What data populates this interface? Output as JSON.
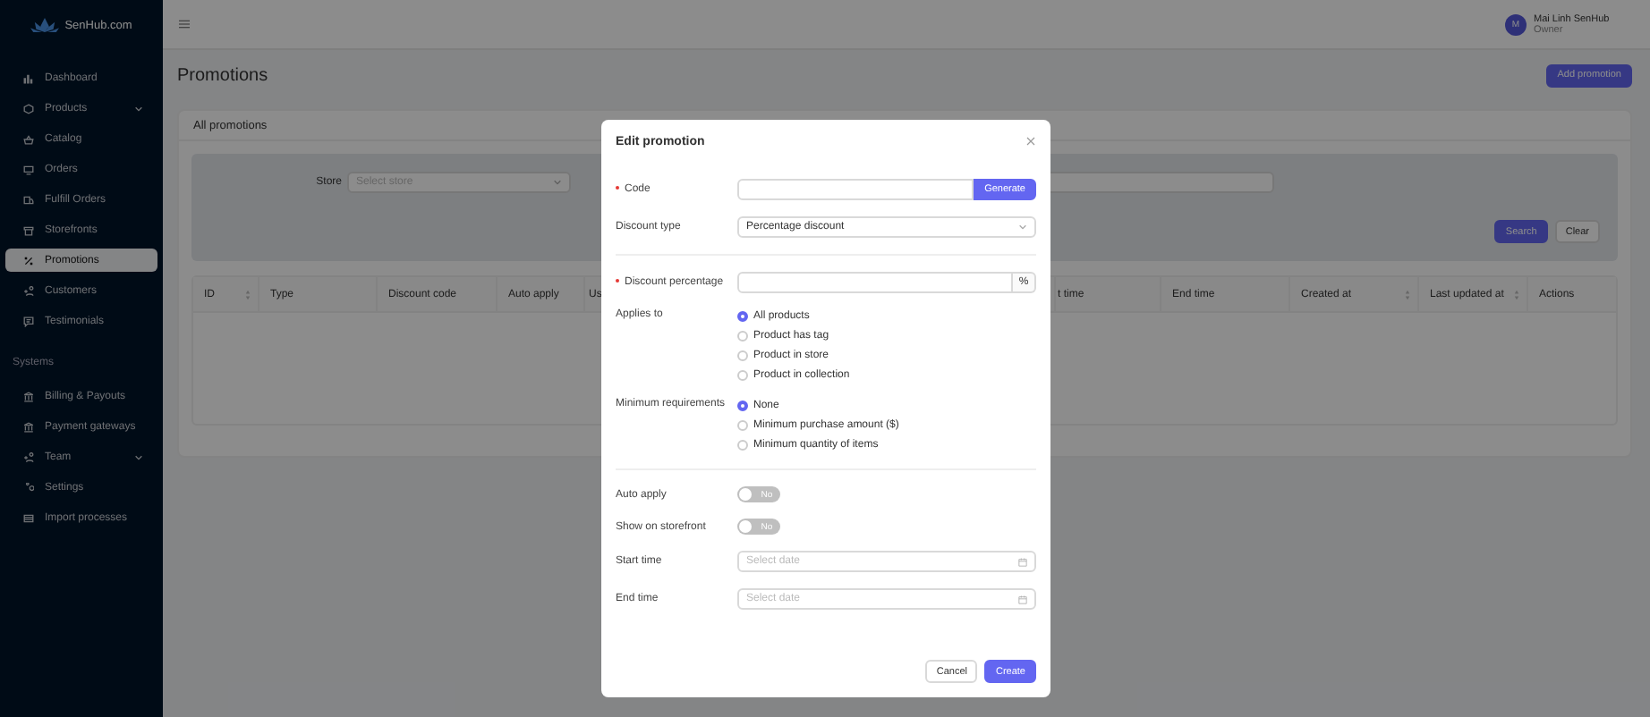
{
  "brand": {
    "name": "SenHub.com"
  },
  "sidebar": {
    "items": [
      {
        "label": "Dashboard",
        "selected": false,
        "has_submenu": false
      },
      {
        "label": "Products",
        "selected": false,
        "has_submenu": true
      },
      {
        "label": "Catalog",
        "selected": false,
        "has_submenu": false
      },
      {
        "label": "Orders",
        "selected": false,
        "has_submenu": false
      },
      {
        "label": "Fulfill Orders",
        "selected": false,
        "has_submenu": false
      },
      {
        "label": "Storefronts",
        "selected": false,
        "has_submenu": false
      },
      {
        "label": "Promotions",
        "selected": true,
        "has_submenu": false
      },
      {
        "label": "Customers",
        "selected": false,
        "has_submenu": false
      },
      {
        "label": "Testimonials",
        "selected": false,
        "has_submenu": false
      }
    ],
    "section_title": "Systems",
    "system_items": [
      {
        "label": "Billing & Payouts",
        "selected": false,
        "has_submenu": false
      },
      {
        "label": "Payment gateways",
        "selected": false,
        "has_submenu": false
      },
      {
        "label": "Team",
        "selected": false,
        "has_submenu": true
      },
      {
        "label": "Settings",
        "selected": false,
        "has_submenu": false
      },
      {
        "label": "Import processes",
        "selected": false,
        "has_submenu": false
      }
    ]
  },
  "header": {
    "user": {
      "initial": "M",
      "name": "Mai Linh SenHub",
      "role": "Owner"
    }
  },
  "page": {
    "title": "Promotions",
    "add_button": "Add promotion"
  },
  "card": {
    "title": "All promotions",
    "filters": {
      "store_label": "Store",
      "store_placeholder": "Select store",
      "search_button": "Search",
      "clear_button": "Clear"
    },
    "table": {
      "columns": [
        {
          "label": "ID",
          "sortable": true
        },
        {
          "label": "Type",
          "sortable": false
        },
        {
          "label": "Discount code",
          "sortable": false
        },
        {
          "label": "Auto apply",
          "sortable": false
        },
        {
          "label": "Us",
          "sortable": false
        },
        {
          "label": "t time",
          "sortable": false
        },
        {
          "label": "End time",
          "sortable": false
        },
        {
          "label": "Created at",
          "sortable": true
        },
        {
          "label": "Last updated at",
          "sortable": true
        },
        {
          "label": "Actions",
          "sortable": false
        }
      ]
    }
  },
  "modal": {
    "title": "Edit promotion",
    "code": {
      "label": "Code",
      "required": true,
      "button": "Generate"
    },
    "discount_type": {
      "label": "Discount type",
      "value": "Percentage discount"
    },
    "discount_percentage": {
      "label": "Discount percentage",
      "required": true,
      "suffix": "%"
    },
    "applies_to": {
      "label": "Applies to",
      "options": [
        {
          "label": "All products",
          "selected": true
        },
        {
          "label": "Product has tag",
          "selected": false
        },
        {
          "label": "Product in store",
          "selected": false
        },
        {
          "label": "Product in collection",
          "selected": false
        }
      ]
    },
    "minimum_requirements": {
      "label": "Minimum requirements",
      "options": [
        {
          "label": "None",
          "selected": true
        },
        {
          "label": "Minimum purchase amount ($)",
          "selected": false
        },
        {
          "label": "Minimum quantity of items",
          "selected": false
        }
      ]
    },
    "toggles": [
      {
        "label": "Auto apply",
        "on": false,
        "state_text": "No"
      },
      {
        "label": "Show on storefront",
        "on": false,
        "state_text": "No"
      }
    ],
    "dates": [
      {
        "label": "Start time",
        "placeholder": "Select date"
      },
      {
        "label": "End time",
        "placeholder": "Select date"
      }
    ],
    "cancel_button": "Cancel",
    "create_button": "Create"
  }
}
